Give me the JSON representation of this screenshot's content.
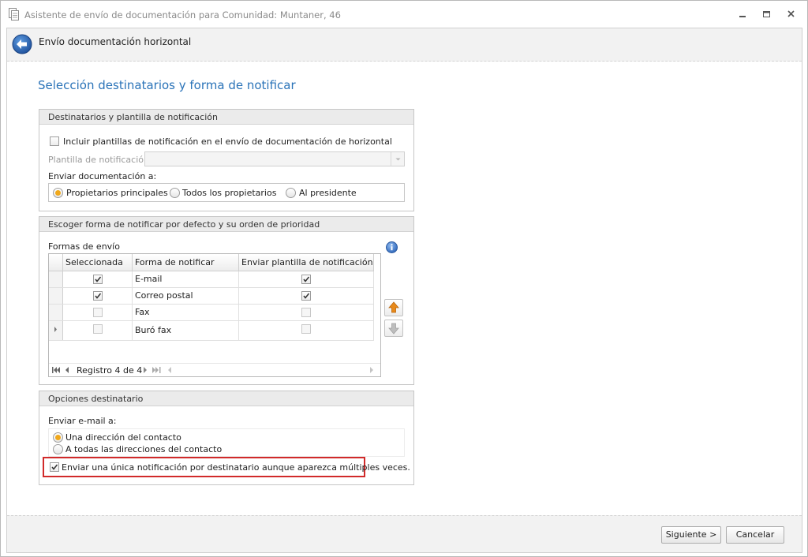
{
  "window": {
    "title": "Asistente de envío de documentación para Comunidad: Muntaner, 46"
  },
  "header": {
    "title": "Envío documentación horizontal"
  },
  "page": {
    "title": "Selección destinatarios y forma de notificar"
  },
  "group_recipients": {
    "title": "Destinatarios y plantilla de notificación",
    "include_templates_label": "Incluir plantillas de notificación en el envío de documentación de horizontal",
    "include_templates_checked": false,
    "template_label": "Plantilla de notificación:",
    "template_value": "",
    "send_to_label": "Enviar documentación a:",
    "send_to_options": [
      {
        "label": "Propietarios principales",
        "selected": true
      },
      {
        "label": "Todos los propietarios",
        "selected": false
      },
      {
        "label": "Al presidente",
        "selected": false
      }
    ]
  },
  "group_methods": {
    "title": "Escoger forma de notificar por defecto y su orden de prioridad",
    "grid_label": "Formas de envío",
    "columns": [
      "Seleccionada",
      "Forma de notificar",
      "Enviar plantilla de notificación"
    ],
    "rows": [
      {
        "selected": true,
        "method": "E-mail",
        "send_template": true,
        "current": false
      },
      {
        "selected": true,
        "method": "Correo postal",
        "send_template": true,
        "current": false
      },
      {
        "selected": false,
        "method": "Fax",
        "send_template": false,
        "current": false
      },
      {
        "selected": false,
        "method": "Buró fax",
        "send_template": false,
        "current": true
      }
    ],
    "navigator_text": "Registro 4 de 4",
    "info_icon": "info-icon",
    "move_up_icon": "arrow-up-icon",
    "move_down_icon": "arrow-down-icon"
  },
  "group_options": {
    "title": "Opciones destinatario",
    "email_label": "Enviar e-mail a:",
    "email_options": [
      {
        "label": "Una dirección del contacto",
        "selected": true
      },
      {
        "label": "A todas las direcciones del contacto",
        "selected": false
      }
    ],
    "single_notification_label": "Enviar una única notificación por destinatario aunque aparezca múltiples veces.",
    "single_notification_checked": true
  },
  "footer": {
    "next_label": "Siguiente >",
    "cancel_label": "Cancelar"
  },
  "colors": {
    "accent": "#2a73b8",
    "radio_selected": "#f0a81c",
    "highlight": "#d12a2a",
    "arrow_up": "#e8891a"
  }
}
